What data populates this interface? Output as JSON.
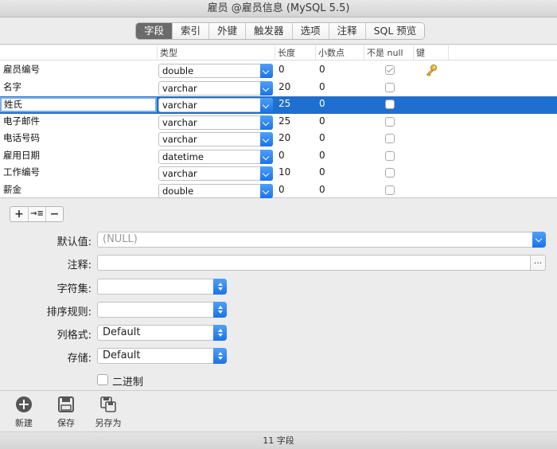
{
  "window": {
    "title": "雇员 @雇员信息 (MySQL 5.5)"
  },
  "tabs": [
    {
      "label": "字段"
    },
    {
      "label": "索引"
    },
    {
      "label": "外键"
    },
    {
      "label": "触发器"
    },
    {
      "label": "选项"
    },
    {
      "label": "注释"
    },
    {
      "label": "SQL 预览"
    }
  ],
  "table": {
    "headers": {
      "type": "类型",
      "length": "长度",
      "decimals": "小数点",
      "not_null": "不是 null",
      "key": "键"
    },
    "rows": [
      {
        "name": "雇员编号",
        "type": "double",
        "length": "0",
        "decimals": "0",
        "not_null": true,
        "key": "key-icon"
      },
      {
        "name": "名字",
        "type": "varchar",
        "length": "20",
        "decimals": "0",
        "not_null": false
      },
      {
        "name": "姓氏",
        "type": "varchar",
        "length": "25",
        "decimals": "0",
        "not_null": false,
        "selected": true
      },
      {
        "name": "电子邮件",
        "type": "varchar",
        "length": "25",
        "decimals": "0",
        "not_null": false
      },
      {
        "name": "电话号码",
        "type": "varchar",
        "length": "20",
        "decimals": "0",
        "not_null": false
      },
      {
        "name": "雇用日期",
        "type": "datetime",
        "length": "0",
        "decimals": "0",
        "not_null": false
      },
      {
        "name": "工作编号",
        "type": "varchar",
        "length": "10",
        "decimals": "0",
        "not_null": false
      },
      {
        "name": "薪金",
        "type": "double",
        "length": "0",
        "decimals": "0",
        "not_null": false
      }
    ]
  },
  "row_buttons": {
    "add": "+",
    "insert": "→≡",
    "remove": "−"
  },
  "props": {
    "default_label": "默认值:",
    "default_placeholder": "(NULL)",
    "comment_label": "注释:",
    "comment_value": "",
    "comment_more": "...",
    "charset_label": "字符集:",
    "charset_value": "",
    "collation_label": "排序规则:",
    "collation_value": "",
    "column_format_label": "列格式:",
    "column_format_value": "Default",
    "storage_label": "存储:",
    "storage_value": "Default",
    "binary_label": "二进制"
  },
  "toolbar": {
    "new_label": "新建",
    "save_label": "保存",
    "save_as_label": "另存为"
  },
  "status": {
    "text": "11 字段"
  },
  "colors": {
    "selection": "#1e6fcf",
    "accent": "#1b72e8"
  }
}
